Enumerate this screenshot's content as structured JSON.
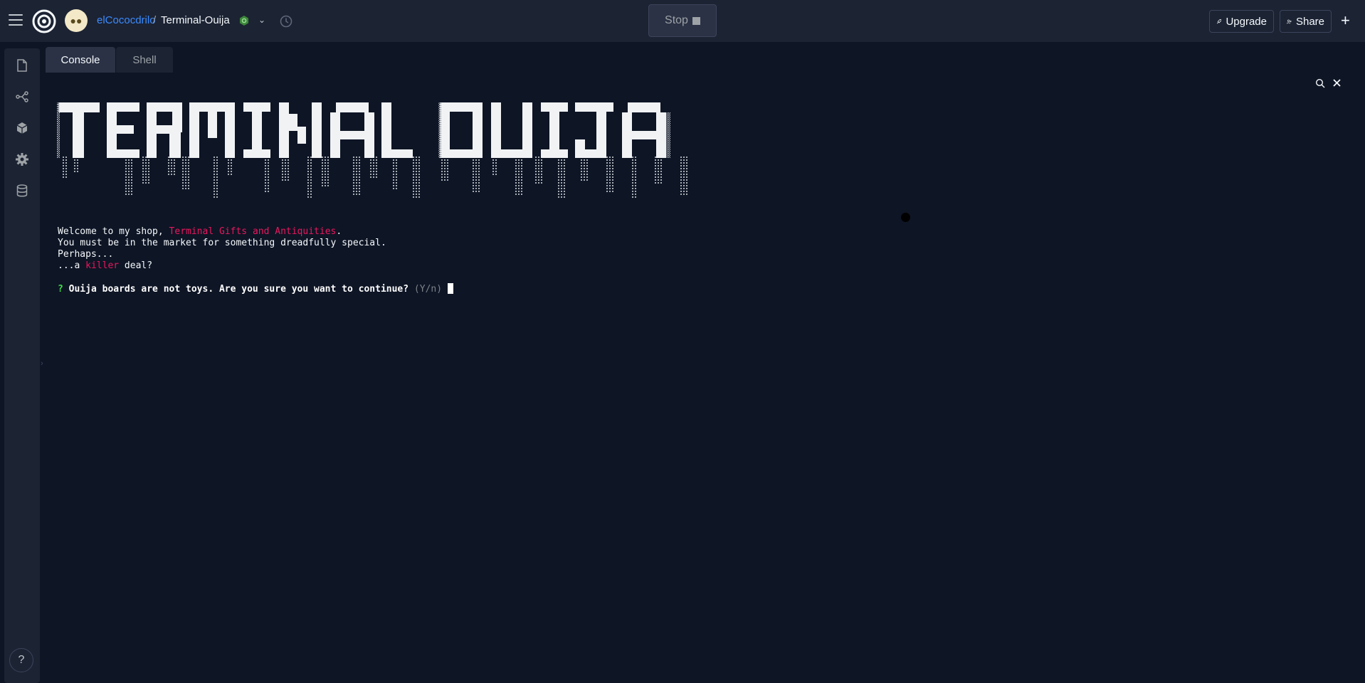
{
  "header": {
    "username": "elCococdrilo",
    "separator": "/",
    "repl_name": "Terminal-Ouija",
    "stop_label": "Stop",
    "upgrade_label": "Upgrade",
    "share_label": "Share"
  },
  "tabs": [
    {
      "label": "Console",
      "active": true
    },
    {
      "label": "Shell",
      "active": false
    }
  ],
  "sidebar": {
    "icons": [
      "files-icon",
      "git-icon",
      "packages-icon",
      "settings-icon",
      "database-icon"
    ],
    "help_label": "?"
  },
  "terminal": {
    "banner_text": "TERMINAL OUIJA",
    "line1_prefix": "Welcome to my shop, ",
    "line1_highlight": "Terminal Gifts and Antiquities",
    "line1_suffix": ".",
    "line2": "You must be in the market for something dreadfully special.",
    "line3": "Perhaps...",
    "line4_prefix": "...a ",
    "line4_highlight": "killer",
    "line4_suffix": " deal?",
    "prompt_marker": "?",
    "prompt_question": "Ouija boards are not toys. Are you sure you want to continue?",
    "prompt_hint": "(Y/n)"
  },
  "colors": {
    "accent_link": "#3b8bff",
    "highlight": "#e8175d",
    "prompt_green": "#3ce04a",
    "background": "#0e1525"
  }
}
